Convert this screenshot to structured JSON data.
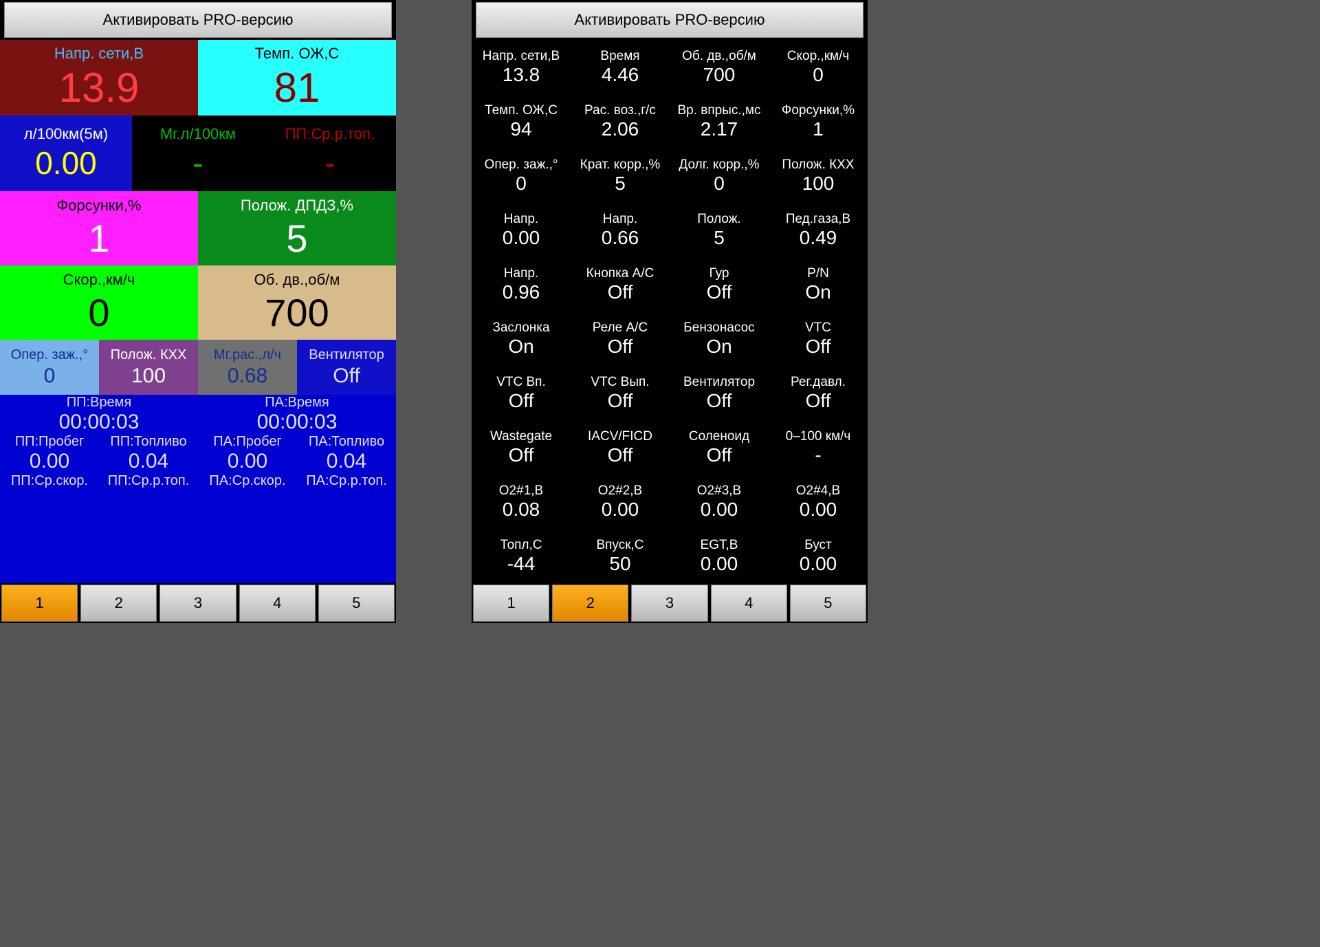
{
  "pro_button": "Активировать PRO-версию",
  "tabs": [
    "1",
    "2",
    "3",
    "4",
    "5"
  ],
  "left": {
    "napr": {
      "label": "Напр. сети,В",
      "value": "13.9"
    },
    "temp": {
      "label": "Темп. ОЖ,С",
      "value": "81"
    },
    "l100": {
      "label": "л/100км(5м)",
      "value": "0.00"
    },
    "mgl": {
      "label": "Мг.л/100км",
      "value": "-"
    },
    "ppsrr": {
      "label": "ПП:Ср.р.топ.",
      "value": "-"
    },
    "fors": {
      "label": "Форсунки,%",
      "value": "1"
    },
    "dpdz": {
      "label": "Полож. ДПДЗ,%",
      "value": "5"
    },
    "skor": {
      "label": "Скор.,км/ч",
      "value": "0"
    },
    "obdv": {
      "label": "Об. дв.,об/м",
      "value": "700"
    },
    "oper": {
      "label": "Опер. заж.,°",
      "value": "0"
    },
    "kxx": {
      "label": "Полож. КХХ",
      "value": "100"
    },
    "mgras": {
      "label": "Мг.рас.,л/ч",
      "value": "0.68"
    },
    "vent": {
      "label": "Вентилятор",
      "value": "Off"
    },
    "trip": {
      "pp_time_lbl": "ПП:Время",
      "pa_time_lbl": "ПА:Время",
      "pp_time": "00:00:03",
      "pa_time": "00:00:03",
      "pp_probeg_lbl": "ПП:Пробег",
      "pp_toplivo_lbl": "ПП:Топливо",
      "pa_probeg_lbl": "ПА:Пробег",
      "pa_toplivo_lbl": "ПА:Топливо",
      "pp_probeg": "0.00",
      "pp_toplivo": "0.04",
      "pa_probeg": "0.00",
      "pa_toplivo": "0.04",
      "pp_srskor_lbl": "ПП:Ср.скор.",
      "pp_srtop_lbl": "ПП:Ср.р.топ.",
      "pa_srskor_lbl": "ПА:Ср.скор.",
      "pa_srtop_lbl": "ПА:Ср.р.топ."
    }
  },
  "right": {
    "cells": [
      {
        "l": "Напр. сети,В",
        "v": "13.8"
      },
      {
        "l": "Время",
        "v": "4.46"
      },
      {
        "l": "Об. дв.,об/м",
        "v": "700"
      },
      {
        "l": "Скор.,км/ч",
        "v": "0"
      },
      {
        "l": "Темп. ОЖ,С",
        "v": "94"
      },
      {
        "l": "Рас. воз.,г/с",
        "v": "2.06"
      },
      {
        "l": "Вр. впрыс.,мс",
        "v": "2.17"
      },
      {
        "l": "Форсунки,%",
        "v": "1"
      },
      {
        "l": "Опер. заж.,°",
        "v": "0"
      },
      {
        "l": "Крат. корр.,%",
        "v": "5"
      },
      {
        "l": "Долг. корр.,%",
        "v": "0"
      },
      {
        "l": "Полож. КХХ",
        "v": "100"
      },
      {
        "l": "Напр.",
        "v": "0.00"
      },
      {
        "l": "Напр.",
        "v": "0.66"
      },
      {
        "l": "Полож.",
        "v": "5"
      },
      {
        "l": "Пед.газа,В",
        "v": "0.49"
      },
      {
        "l": "Напр.",
        "v": "0.96"
      },
      {
        "l": "Кнопка А/С",
        "v": "Off"
      },
      {
        "l": "Гур",
        "v": "Off"
      },
      {
        "l": "P/N",
        "v": "On"
      },
      {
        "l": "Заслонка",
        "v": "On"
      },
      {
        "l": "Реле А/С",
        "v": "Off"
      },
      {
        "l": "Бензонасос",
        "v": "On"
      },
      {
        "l": "VTC",
        "v": "Off"
      },
      {
        "l": "VTC Вп.",
        "v": "Off"
      },
      {
        "l": "VTC Вып.",
        "v": "Off"
      },
      {
        "l": "Вентилятор",
        "v": "Off"
      },
      {
        "l": "Рег.давл.",
        "v": "Off"
      },
      {
        "l": "Wastegate",
        "v": "Off"
      },
      {
        "l": "IACV/FICD",
        "v": "Off"
      },
      {
        "l": "Соленоид",
        "v": "Off"
      },
      {
        "l": "0–100 км/ч",
        "v": "-"
      },
      {
        "l": "О2#1,В",
        "v": "0.08"
      },
      {
        "l": "О2#2,В",
        "v": "0.00"
      },
      {
        "l": "О2#3,В",
        "v": "0.00"
      },
      {
        "l": "О2#4,В",
        "v": "0.00"
      },
      {
        "l": "Топл,С",
        "v": "-44"
      },
      {
        "l": "Впуск,С",
        "v": "50"
      },
      {
        "l": "EGT,В",
        "v": "0.00"
      },
      {
        "l": "Буст",
        "v": "0.00"
      }
    ]
  }
}
